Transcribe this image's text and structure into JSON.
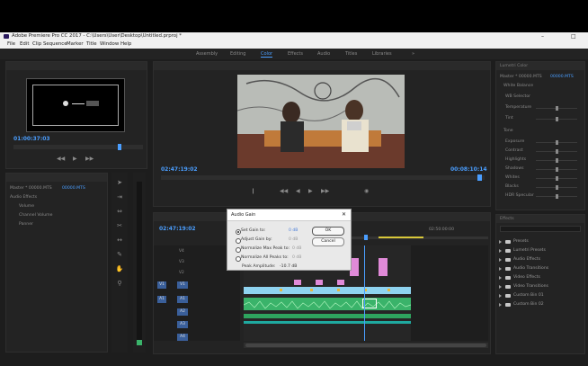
{
  "window": {
    "title": "Adobe Premiere Pro CC 2017 - C:\\Users\\User\\Desktop\\Untitled.prproj *",
    "minimize": "–",
    "maximize": "□"
  },
  "menu": [
    "File",
    "Edit",
    "Clip",
    "Sequence",
    "Marker",
    "Title",
    "Window",
    "Help"
  ],
  "workspaces": {
    "items": [
      "Assembly",
      "Editing",
      "Color",
      "Effects",
      "Audio",
      "Titles",
      "Libraries"
    ],
    "active_index": 2,
    "more": "»"
  },
  "source_monitor": {
    "timecode": "01:00:37:03"
  },
  "program_monitor": {
    "timecode": "02:47:19:02",
    "duration": "00:08:10:14"
  },
  "effect_controls": {
    "tab": "Lumetri Color",
    "clip": "Master * 00000.MTS",
    "sequence": "00000.MTS",
    "section_basic": "White Balance",
    "section_tone": "Tone",
    "tone_rows": [
      "Exposure",
      "Contrast",
      "Highlights",
      "Shadows",
      "Whites",
      "Blacks",
      "HDR Specular"
    ],
    "wb_rows": [
      "WB Selector",
      "Temperature",
      "Tint"
    ]
  },
  "audio_mixer": {
    "clip": "Master * 00000.MTS",
    "sequence": "00000.MTS",
    "rows": [
      "Audio Effects",
      "Volume",
      "Channel Volume",
      "Panner"
    ]
  },
  "timeline": {
    "timecode": "02:47:19:02",
    "ruler_time": "02:50:00:00",
    "video_tracks": [
      "V4",
      "V3",
      "V2",
      "V1"
    ],
    "audio_tracks": [
      "A1",
      "A2",
      "A3",
      "A4"
    ],
    "source_patch_v": "V1",
    "source_patch_a": "A1"
  },
  "audio_gain": {
    "title": "Audio Gain",
    "close": "✕",
    "options": [
      {
        "label": "Set Gain to:",
        "value": "0 dB",
        "selected": true
      },
      {
        "label": "Adjust Gain by:",
        "value": "0 dB",
        "selected": false
      },
      {
        "label": "Normalize Max Peak to:",
        "value": "0 dB",
        "selected": false
      },
      {
        "label": "Normalize All Peaks to:",
        "value": "0 dB",
        "selected": false
      }
    ],
    "peak_label": "Peak Amplitude:",
    "peak_value": "-10.7 dB",
    "ok": "OK",
    "cancel": "Cancel"
  },
  "effects_panel": {
    "tab": "Effects",
    "items": [
      "Presets",
      "Lumetri Presets",
      "Audio Effects",
      "Audio Transitions",
      "Video Effects",
      "Video Transitions",
      "Custom Bin 01",
      "Custom Bin 02"
    ]
  },
  "colors": {
    "accent": "#4a9eff",
    "clip_video": "#8fd3f0",
    "clip_audio": "#3ab36a",
    "clip_pink": "#e08ad8",
    "playhead": "#4a9eff"
  }
}
